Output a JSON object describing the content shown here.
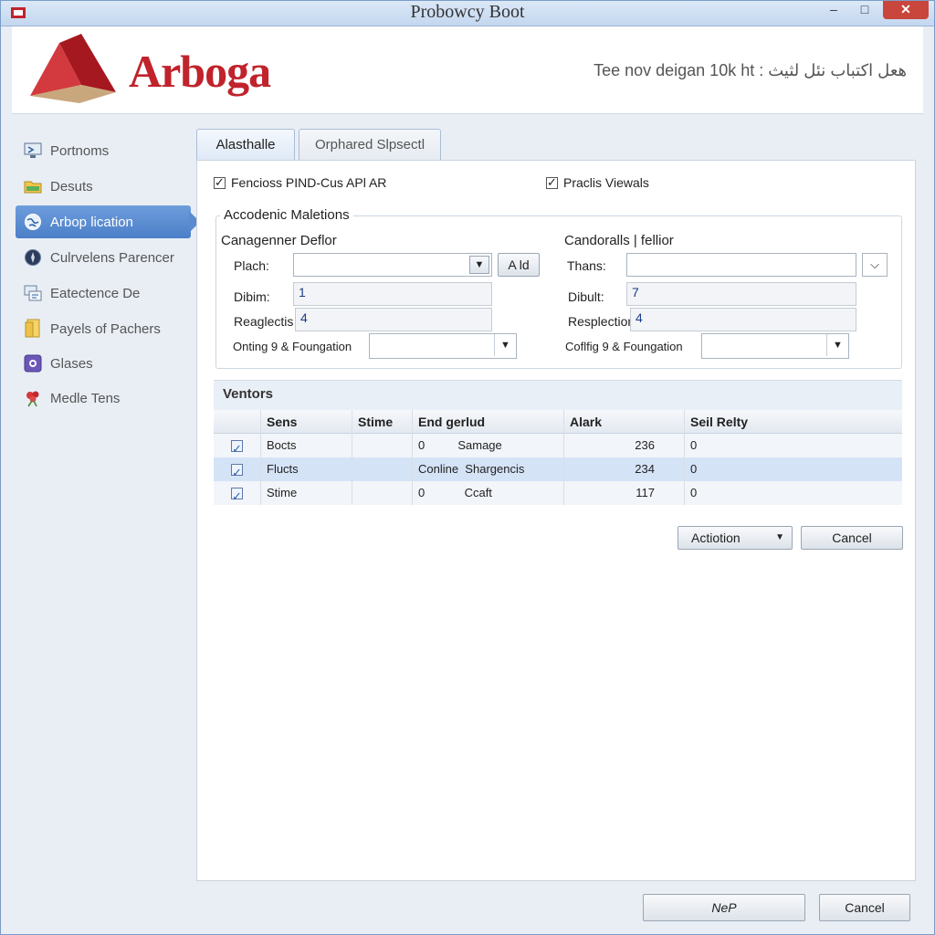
{
  "window": {
    "title": "Probowcy Boot"
  },
  "window_controls": {
    "minimize": "–",
    "maximize": "□",
    "close": "✕"
  },
  "header": {
    "logo_text": "Arboga",
    "tagline": "Tee nov deigan 10k ht : هعل اكتباب نئل لثيث"
  },
  "sidebar": {
    "items": [
      {
        "label": "Portnoms",
        "icon": "monitor-icon",
        "active": false
      },
      {
        "label": "Desuts",
        "icon": "folder-icon",
        "active": false
      },
      {
        "label": "Arbop lication",
        "icon": "globe-icon",
        "active": true
      },
      {
        "label": "Culrvelens Parencer",
        "icon": "compass-icon",
        "active": false
      },
      {
        "label": "Eatectence De",
        "icon": "network-icon",
        "active": false
      },
      {
        "label": "Payels of Pachers",
        "icon": "document-icon",
        "active": false
      },
      {
        "label": "Glases",
        "icon": "window-icon",
        "active": false
      },
      {
        "label": "Medle Tens",
        "icon": "flower-icon",
        "active": false
      }
    ]
  },
  "tabs": [
    {
      "label": "Alasthalle",
      "active": true
    },
    {
      "label": "Orphared Slpsectl",
      "active": false
    }
  ],
  "options": {
    "left_checkbox": {
      "label": "Fencioss PIND-Cus APl AR",
      "checked": true
    },
    "right_checkbox": {
      "label": "Praclis Viewals",
      "checked": true
    }
  },
  "group": {
    "title": "Accodenic Maletions",
    "left": {
      "heading": "Canagenner Deflor",
      "field1_label": "Plach:",
      "field1_value": "",
      "add_button": "A ld",
      "field2_label": "Dibim:",
      "field2_value": "1",
      "field3_label": "Reaglectis",
      "field3_value": "4",
      "field4_label": "Onting 9 & Foungation",
      "field4_value": ""
    },
    "right": {
      "heading": "Candoralls | fellior",
      "field1_label": "Thans:",
      "field1_value": "",
      "field2_label": "Dibult:",
      "field2_value": "7",
      "field3_label": "Resplection",
      "field3_value": "4",
      "field4_label": "Coflfig 9 & Foungation",
      "field4_value": ""
    }
  },
  "vendors": {
    "title": "Ventors",
    "columns": [
      "",
      "Sens",
      "Stime",
      "End gerlud",
      "Alark",
      "Seil Relty"
    ],
    "rows": [
      {
        "checked": true,
        "sens": "Bocts",
        "stime": "",
        "end": "0          Samage",
        "alark": "236",
        "relty": "0"
      },
      {
        "checked": true,
        "sens": "Flucts",
        "stime": "",
        "end": "Conline  Shargencis",
        "alark": "234",
        "relty": "0"
      },
      {
        "checked": true,
        "sens": "Stime",
        "stime": "",
        "end": "0            Ccaft",
        "alark": "117",
        "relty": "0"
      }
    ]
  },
  "actions": {
    "action_button": "Actiotion",
    "cancel_button": "Cancel"
  },
  "footer": {
    "next_button": "NeP",
    "cancel_button": "Cancel"
  },
  "colors": {
    "brand": "#c0232b",
    "accent": "#4b7fc8",
    "selection": "#d5e3f7"
  }
}
